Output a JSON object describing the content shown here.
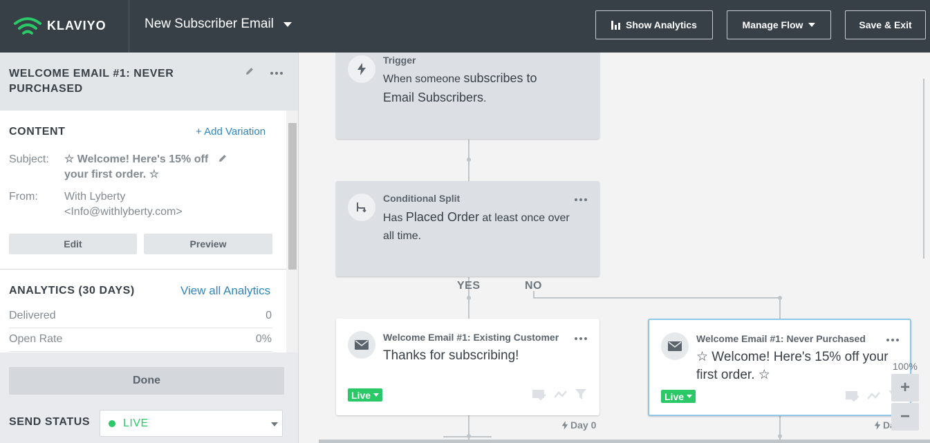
{
  "app": {
    "brand": "KLAVIYO",
    "flow_title": "New Subscriber Email"
  },
  "toolbar": {
    "show_analytics": "Show Analytics",
    "manage_flow": "Manage Flow",
    "save_exit": "Save & Exit"
  },
  "sidebar": {
    "title_line1": "WELCOME EMAIL #1: NEVER",
    "title_line2": "PURCHASED",
    "content_heading": "CONTENT",
    "add_variation": "+ Add Variation",
    "subject_label": "Subject:",
    "subject_line1": "☆ Welcome! Here's 15% off",
    "subject_line2": "your first order. ☆",
    "from_label": "From:",
    "from_line1": "With Lyberty",
    "from_line2": "<Info@withlyberty.com>",
    "edit_button": "Edit",
    "preview_button": "Preview",
    "analytics_heading": "ANALYTICS (30 DAYS)",
    "view_all_analytics": "View all Analytics",
    "stats": [
      {
        "label": "Delivered",
        "value": "0"
      },
      {
        "label": "Open Rate",
        "value": "0%"
      }
    ],
    "done_button": "Done",
    "send_status_label": "SEND STATUS",
    "send_status_value": "LIVE",
    "send_status_color": "#2ac866"
  },
  "canvas": {
    "trigger": {
      "type": "Trigger",
      "text_pre": "When someone ",
      "text_bold": "subscribes to",
      "text_bold2": "Email Subscribers",
      "text_post": "."
    },
    "split": {
      "type": "Conditional Split",
      "text_pre": "Has ",
      "text_bold": "Placed Order",
      "text_post": " at least once over",
      "text_line2": "all time."
    },
    "yes_label": "YES",
    "no_label": "NO",
    "email_left": {
      "type": "Welcome Email #1: Existing Customer",
      "body": "Thanks for subscribing!",
      "status": "Live",
      "day": "Day 0"
    },
    "email_right": {
      "type": "Welcome Email #1: Never Purchased",
      "body_line1": "☆ Welcome! Here's 15% off your",
      "body_line2": "first order. ☆",
      "status": "Live",
      "day": "Day"
    },
    "zoom": {
      "level": "100%",
      "zoom_in": "+",
      "zoom_out": "−"
    }
  },
  "colors": {
    "topbar": "#373f47",
    "accent_link": "#2e86c1",
    "live_green": "#2ac866",
    "selected_border": "#8ec7e8"
  },
  "icons": [
    "klaviyo-logo-icon",
    "chevron-down-icon",
    "bar-chart-icon",
    "pencil-icon",
    "more-dots-icon",
    "lightning-icon",
    "split-icon",
    "envelope-icon",
    "mail-check-icon",
    "trend-icon",
    "filter-icon"
  ]
}
